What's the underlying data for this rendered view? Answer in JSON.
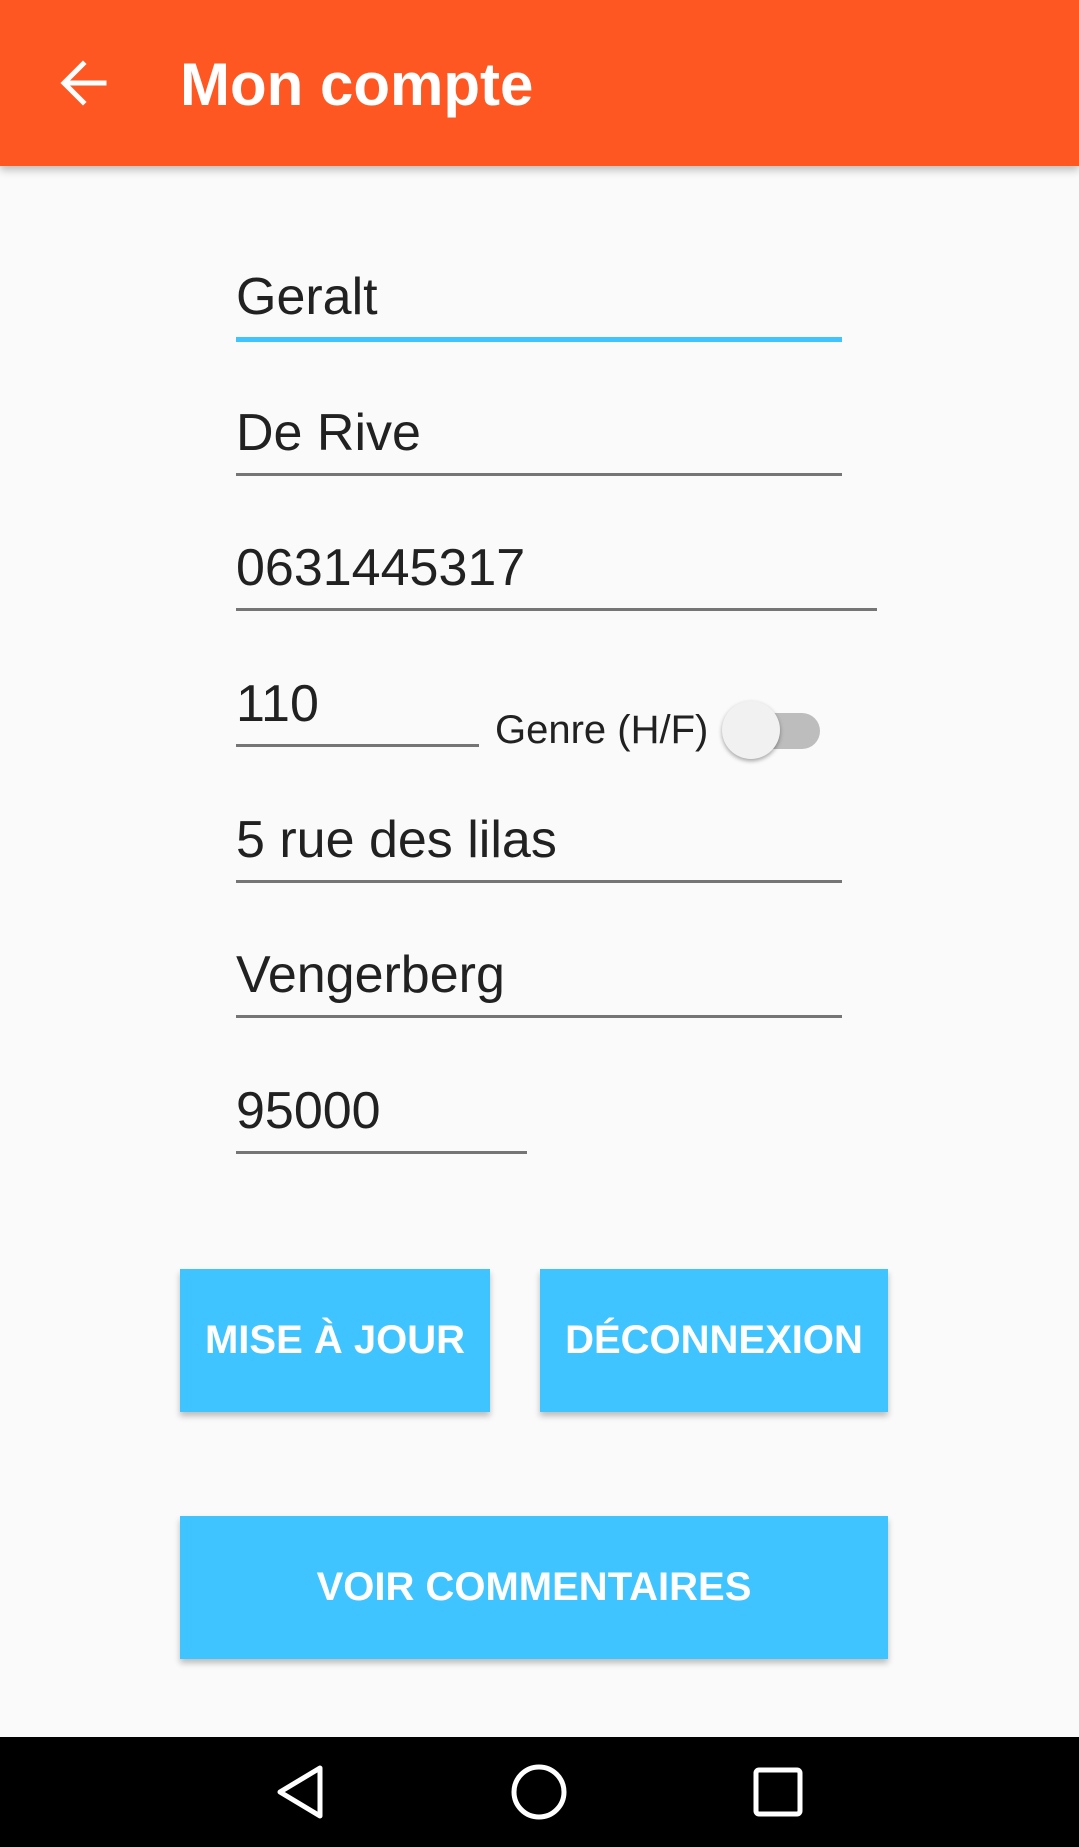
{
  "appbar": {
    "title": "Mon compte",
    "color": "#ff5722",
    "back_icon": "arrow-back-icon"
  },
  "form": {
    "first_name": "Geralt",
    "last_name": "De Rive",
    "phone": "0631445317",
    "age": "110",
    "gender_label": "Genre (H/F)",
    "gender_switch_on": false,
    "address": "5 rue des lilas",
    "city": "Vengerberg",
    "postal_code": "95000"
  },
  "buttons": {
    "update": "MISE À JOUR",
    "logout": "DÉCONNEXION",
    "comments": "VOIR COMMENTAIRES",
    "color": "#40c4ff"
  },
  "navbar": {
    "back_icon": "triangle-back-icon",
    "home_icon": "circle-home-icon",
    "recents_icon": "square-recents-icon"
  },
  "colors": {
    "accent_focus": "#40c4ff",
    "underline": "#757575",
    "background": "#fafafa"
  }
}
